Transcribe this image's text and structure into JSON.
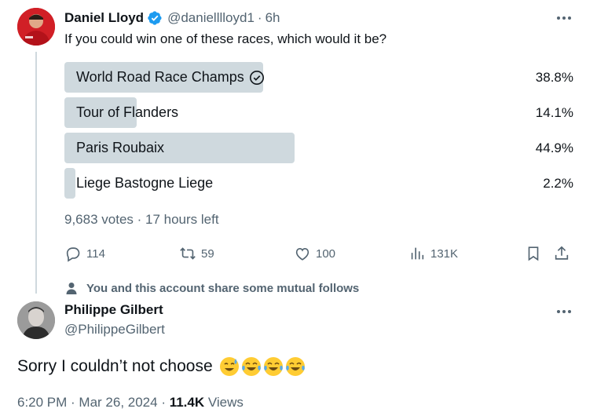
{
  "tweet": {
    "author_name": "Daniel Lloyd",
    "handle": "@danielllloyd1",
    "separator": "·",
    "time": "6h",
    "text": "If you could win one of these races, which would it be?"
  },
  "poll": {
    "options": [
      {
        "label": "World Road Race Champs",
        "percent": "38.8%",
        "fill": 0.388,
        "selected": true
      },
      {
        "label": "Tour of Flanders",
        "percent": "14.1%",
        "fill": 0.141,
        "selected": false
      },
      {
        "label": "Paris Roubaix",
        "percent": "44.9%",
        "fill": 0.449,
        "selected": false
      },
      {
        "label": "Liege Bastogne Liege",
        "percent": "2.2%",
        "fill": 0.022,
        "selected": false
      }
    ],
    "meta": "9,683 votes · 17 hours left"
  },
  "actions": {
    "replies": "114",
    "reposts": "59",
    "likes": "100",
    "views": "131K"
  },
  "mutual_follow_note": "You and this account share some mutual follows",
  "reply": {
    "author_name": "Philippe Gilbert",
    "handle": "@PhilippeGilbert",
    "text": "Sorry I couldn’t not choose",
    "emojis": [
      "sweat-smile-emoji",
      "tears-of-joy-emoji",
      "tears-of-joy-emoji",
      "tears-of-joy-emoji"
    ],
    "footer_datetime": "6:20 PM · Mar 26, 2024 · ",
    "footer_views_count": "11.4K",
    "footer_views_label": " Views"
  },
  "colors": {
    "verified_blue": "#1d9bf0",
    "poll_bar": "#cfd9de",
    "secondary_text": "#536471",
    "primary_text": "#0f1419"
  },
  "icons": [
    "verified-badge-icon",
    "more-icon",
    "check-circle-icon",
    "reply-icon",
    "repost-icon",
    "like-icon",
    "views-icon",
    "bookmark-icon",
    "share-icon",
    "person-icon"
  ]
}
